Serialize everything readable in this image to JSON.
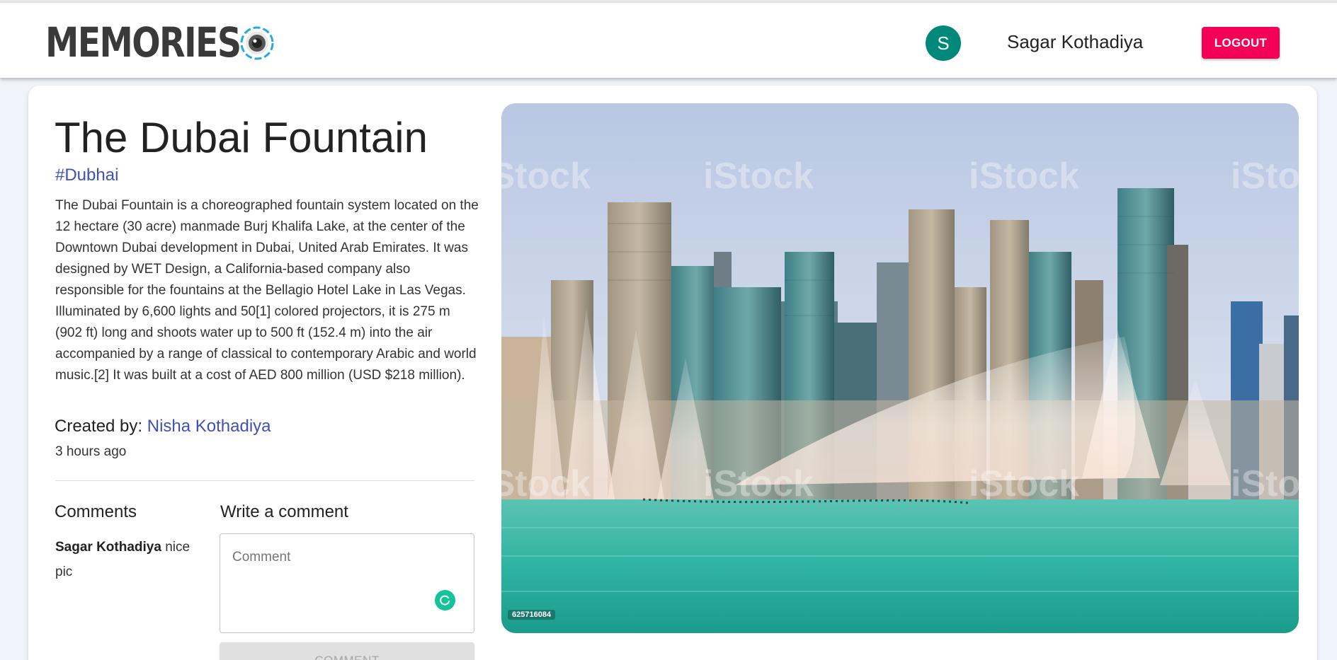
{
  "header": {
    "brand": "MEMORIES",
    "avatar_initial": "S",
    "user_name": "Sagar Kothadiya",
    "logout_label": "LOGOUT"
  },
  "post": {
    "title": "The Dubai Fountain",
    "tags": "#Dubhai",
    "description": "The Dubai Fountain is a choreographed fountain system located on the 12 hectare (30 acre) manmade Burj Khalifa Lake, at the center of the Downtown Dubai development in Dubai, United Arab Emirates. It was designed by WET Design, a California-based company also responsible for the fountains at the Bellagio Hotel Lake in Las Vegas. Illuminated by 6,600 lights and 50[1] colored projectors, it is 275 m (902 ft) long and shoots water up to 500 ft (152.4 m) into the air accompanied by a range of classical to contemporary Arabic and world music.[2] It was built at a cost of AED 800 million (USD $218 million).",
    "created_by_label": "Created by: ",
    "author": "Nisha Kothadiya",
    "time_ago": "3 hours ago",
    "image_stock_id": "625716084"
  },
  "comments": {
    "title": "Comments",
    "items": [
      {
        "author": "Sagar Kothadiya",
        "text": " nice pic"
      }
    ]
  },
  "write_comment": {
    "title": "Write a comment",
    "placeholder": "Comment",
    "value": "",
    "button_label": "COMMENT"
  },
  "colors": {
    "accent_blue": "#3f51b5",
    "logout_pink": "#f50057",
    "avatar_teal": "#00897b"
  }
}
